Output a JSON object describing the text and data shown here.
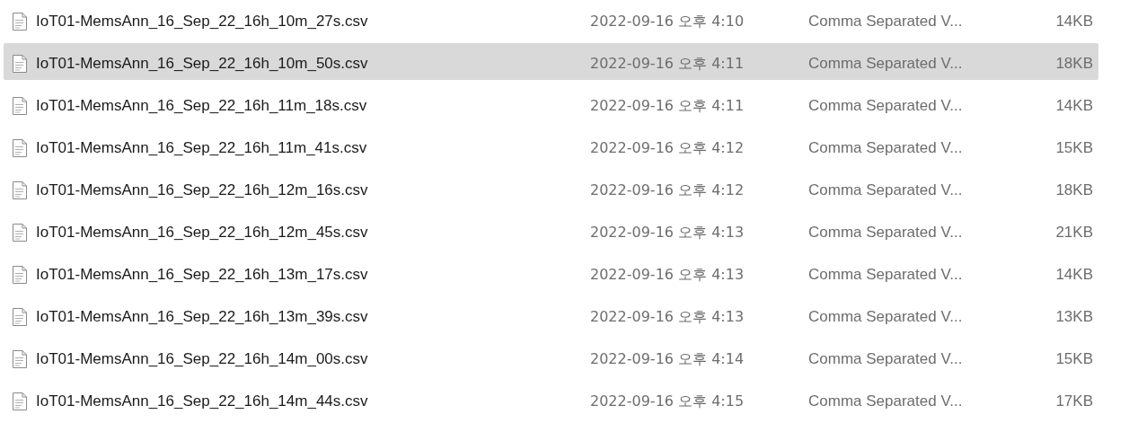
{
  "files": [
    {
      "name": "IoT01-MemsAnn_16_Sep_22_16h_10m_27s.csv",
      "modified": "2022-09-16 오후 4:10",
      "type": "Comma Separated V...",
      "size": "14KB",
      "selected": false
    },
    {
      "name": "IoT01-MemsAnn_16_Sep_22_16h_10m_50s.csv",
      "modified": "2022-09-16 오후 4:11",
      "type": "Comma Separated V...",
      "size": "18KB",
      "selected": true
    },
    {
      "name": "IoT01-MemsAnn_16_Sep_22_16h_11m_18s.csv",
      "modified": "2022-09-16 오후 4:11",
      "type": "Comma Separated V...",
      "size": "14KB",
      "selected": false
    },
    {
      "name": "IoT01-MemsAnn_16_Sep_22_16h_11m_41s.csv",
      "modified": "2022-09-16 오후 4:12",
      "type": "Comma Separated V...",
      "size": "15KB",
      "selected": false
    },
    {
      "name": "IoT01-MemsAnn_16_Sep_22_16h_12m_16s.csv",
      "modified": "2022-09-16 오후 4:12",
      "type": "Comma Separated V...",
      "size": "18KB",
      "selected": false
    },
    {
      "name": "IoT01-MemsAnn_16_Sep_22_16h_12m_45s.csv",
      "modified": "2022-09-16 오후 4:13",
      "type": "Comma Separated V...",
      "size": "21KB",
      "selected": false
    },
    {
      "name": "IoT01-MemsAnn_16_Sep_22_16h_13m_17s.csv",
      "modified": "2022-09-16 오후 4:13",
      "type": "Comma Separated V...",
      "size": "14KB",
      "selected": false
    },
    {
      "name": "IoT01-MemsAnn_16_Sep_22_16h_13m_39s.csv",
      "modified": "2022-09-16 오후 4:13",
      "type": "Comma Separated V...",
      "size": "13KB",
      "selected": false
    },
    {
      "name": "IoT01-MemsAnn_16_Sep_22_16h_14m_00s.csv",
      "modified": "2022-09-16 오후 4:14",
      "type": "Comma Separated V...",
      "size": "15KB",
      "selected": false
    },
    {
      "name": "IoT01-MemsAnn_16_Sep_22_16h_14m_44s.csv",
      "modified": "2022-09-16 오후 4:15",
      "type": "Comma Separated V...",
      "size": "17KB",
      "selected": false
    }
  ]
}
